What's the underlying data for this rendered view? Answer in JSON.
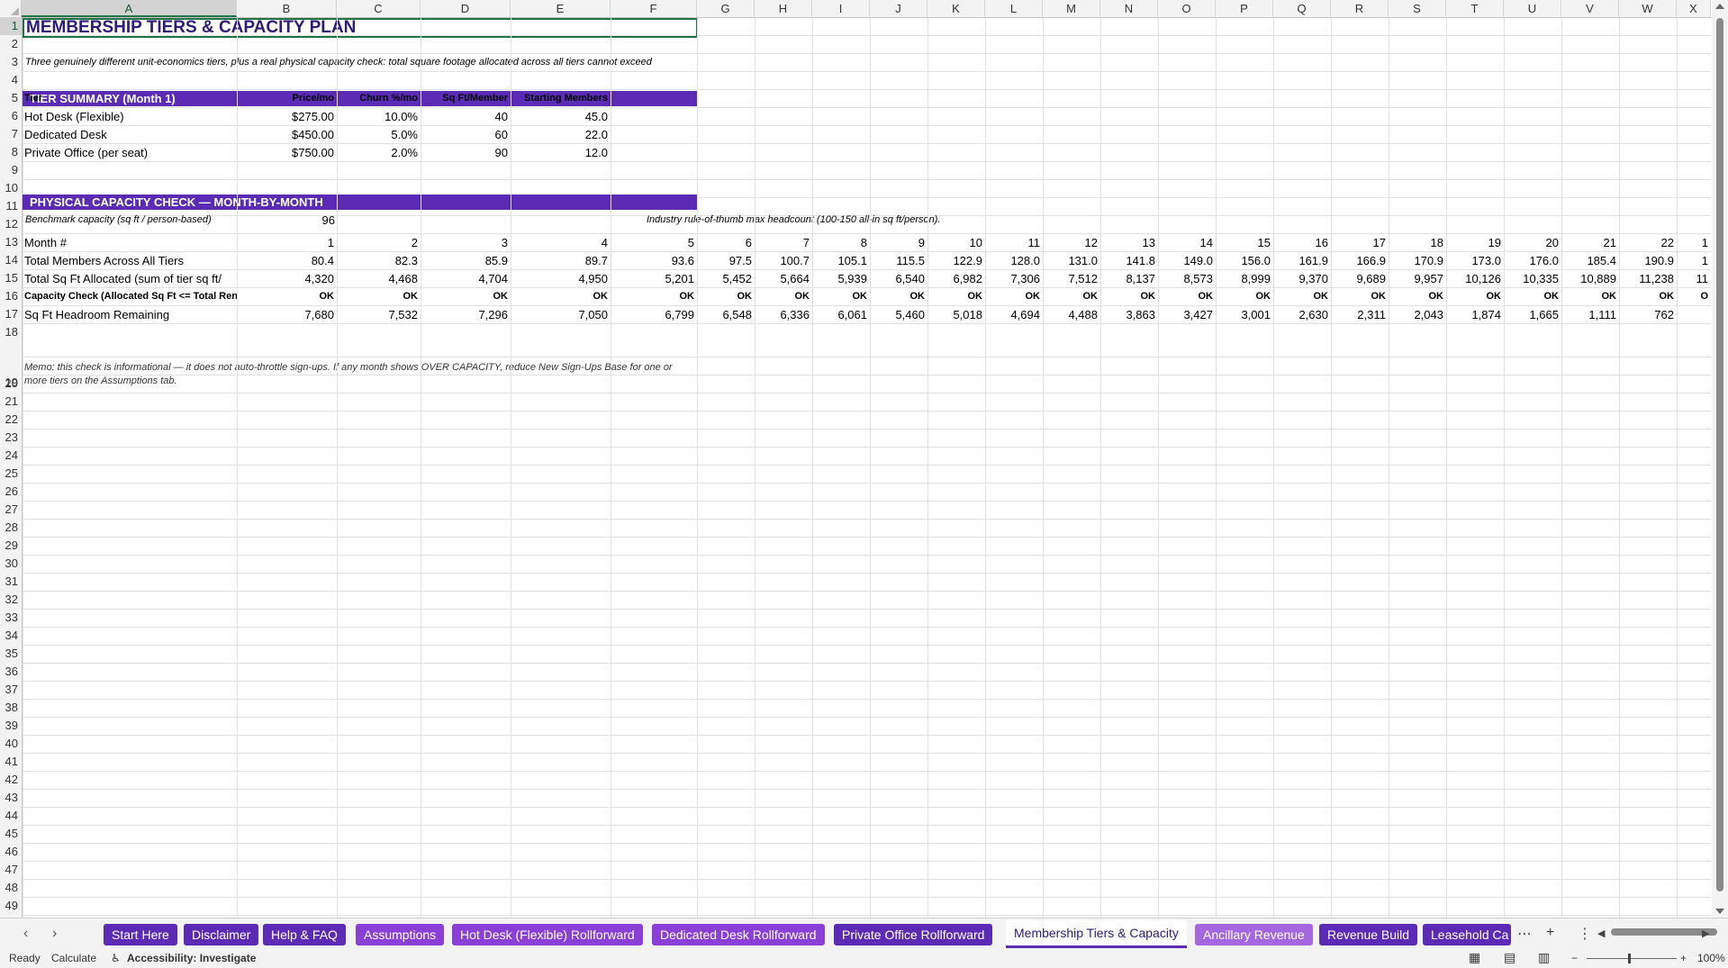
{
  "columns": [
    "A",
    "B",
    "C",
    "D",
    "E",
    "F",
    "G",
    "H",
    "I",
    "J",
    "K",
    "L",
    "M",
    "N",
    "O",
    "P",
    "Q",
    "R",
    "S",
    "T",
    "U",
    "V",
    "W",
    "X"
  ],
  "rows": [
    "1",
    "2",
    "3",
    "4",
    "5",
    "6",
    "7",
    "8",
    "9",
    "10",
    "11",
    "12",
    "13",
    "14",
    "15",
    "16",
    "17",
    "18",
    "19",
    "20",
    "21",
    "22",
    "23",
    "24",
    "25",
    "26",
    "27",
    "28",
    "29",
    "30",
    "31",
    "32",
    "33",
    "34",
    "35",
    "36",
    "37",
    "38",
    "39",
    "40",
    "41",
    "42",
    "43",
    "44",
    "45",
    "46",
    "47",
    "48",
    "49"
  ],
  "sheet": {
    "title": "MEMBERSHIP TIERS & CAPACITY PLAN",
    "subtitle": "Three genuinely different unit-economics tiers, plus a real physical capacity check: total square footage allocated across all tiers cannot exceed",
    "tier_band": "TIER SUMMARY (Month 1)",
    "tier_headers": [
      "Tier",
      "Price/mo",
      "Churn %/mo",
      "Sq Ft/Member",
      "Starting Members"
    ],
    "tiers": [
      [
        "Hot Desk (Flexible)",
        "$275.00",
        "10.0%",
        "40",
        "45.0"
      ],
      [
        "Dedicated Desk",
        "$450.00",
        "5.0%",
        "60",
        "22.0"
      ],
      [
        "Private Office (per seat)",
        "$750.00",
        "2.0%",
        "90",
        "12.0"
      ]
    ],
    "capacity_band": "PHYSICAL CAPACITY CHECK — MONTH-BY-MONTH",
    "benchmark_label": "Benchmark capacity (sq ft / person-based)",
    "benchmark_value": "96",
    "benchmark_note": "Industry rule-of-thumb max headcount (100-150 all-in sq ft/person).",
    "labels": {
      "month": "Month #",
      "members": "Total Members Across All Tiers",
      "sqft": "Total Sq Ft Allocated (sum of tier sq ft/",
      "check": "Capacity Check (Allocated Sq Ft <= Total Ren",
      "headroom": "Sq Ft Headroom Remaining"
    },
    "months": [
      "1",
      "2",
      "3",
      "4",
      "5",
      "6",
      "7",
      "8",
      "9",
      "10",
      "11",
      "12",
      "13",
      "14",
      "15",
      "16",
      "17",
      "18",
      "19",
      "20",
      "21",
      "22",
      "1"
    ],
    "members": [
      "80.4",
      "82.3",
      "85.9",
      "89.7",
      "93.6",
      "97.5",
      "100.7",
      "105.1",
      "115.5",
      "122.9",
      "128.0",
      "131.0",
      "141.8",
      "149.0",
      "156.0",
      "161.9",
      "166.9",
      "170.9",
      "173.0",
      "176.0",
      "185.4",
      "190.9",
      "1"
    ],
    "sqft": [
      "4,320",
      "4,468",
      "4,704",
      "4,950",
      "5,201",
      "5,452",
      "5,664",
      "5,939",
      "6,540",
      "6,982",
      "7,306",
      "7,512",
      "8,137",
      "8,573",
      "8,999",
      "9,370",
      "9,689",
      "9,957",
      "10,126",
      "10,335",
      "10,889",
      "11,238",
      "11"
    ],
    "check": [
      "OK",
      "OK",
      "OK",
      "OK",
      "OK",
      "OK",
      "OK",
      "OK",
      "OK",
      "OK",
      "OK",
      "OK",
      "OK",
      "OK",
      "OK",
      "OK",
      "OK",
      "OK",
      "OK",
      "OK",
      "OK",
      "OK",
      "O"
    ],
    "headroom": [
      "7,680",
      "7,532",
      "7,296",
      "7,050",
      "6,799",
      "6,548",
      "6,336",
      "6,061",
      "5,460",
      "5,018",
      "4,694",
      "4,488",
      "3,863",
      "3,427",
      "3,001",
      "2,630",
      "2,311",
      "2,043",
      "1,874",
      "1,665",
      "1,111",
      "762",
      ""
    ],
    "memo_line1": "Memo: this check is informational — it does not auto-throttle sign-ups. If any month shows OVER CAPACITY, reduce New Sign-Ups Base for one or",
    "memo_line2": "more tiers on the Assumptions tab."
  },
  "tabs": [
    {
      "label": "Start Here",
      "color": "#5b2bb5"
    },
    {
      "label": "Disclaimer",
      "color": "#5b2bb5"
    },
    {
      "label": "Help & FAQ",
      "color": "#5b2bb5"
    },
    {
      "label": "Assumptions",
      "color": "#8a3fd6"
    },
    {
      "label": "Hot Desk (Flexible) Rollforward",
      "color": "#8a3fd6"
    },
    {
      "label": "Dedicated Desk Rollforward",
      "color": "#8a3fd6"
    },
    {
      "label": "Private Office Rollforward",
      "color": "#5b2bb5"
    },
    {
      "label": "Membership Tiers & Capacity",
      "color": "#ffffff",
      "active": true
    },
    {
      "label": "Ancillary Revenue",
      "color": "#a467e0"
    },
    {
      "label": "Revenue Build",
      "color": "#5b2bb5"
    },
    {
      "label": "Leasehold Ca",
      "color": "#5b2bb5"
    }
  ],
  "tabbar_icons": {
    "more": "⋯",
    "add": "+",
    "menu": "⋮",
    "prev": "◀",
    "next": "▶",
    "nav_prev": "‹",
    "nav_next": "›"
  },
  "status": {
    "ready": "Ready",
    "calculate": "Calculate",
    "accessibility": "Accessibility: Investigate",
    "zoom": "100%",
    "zoom_minus": "−",
    "zoom_plus": "+"
  }
}
